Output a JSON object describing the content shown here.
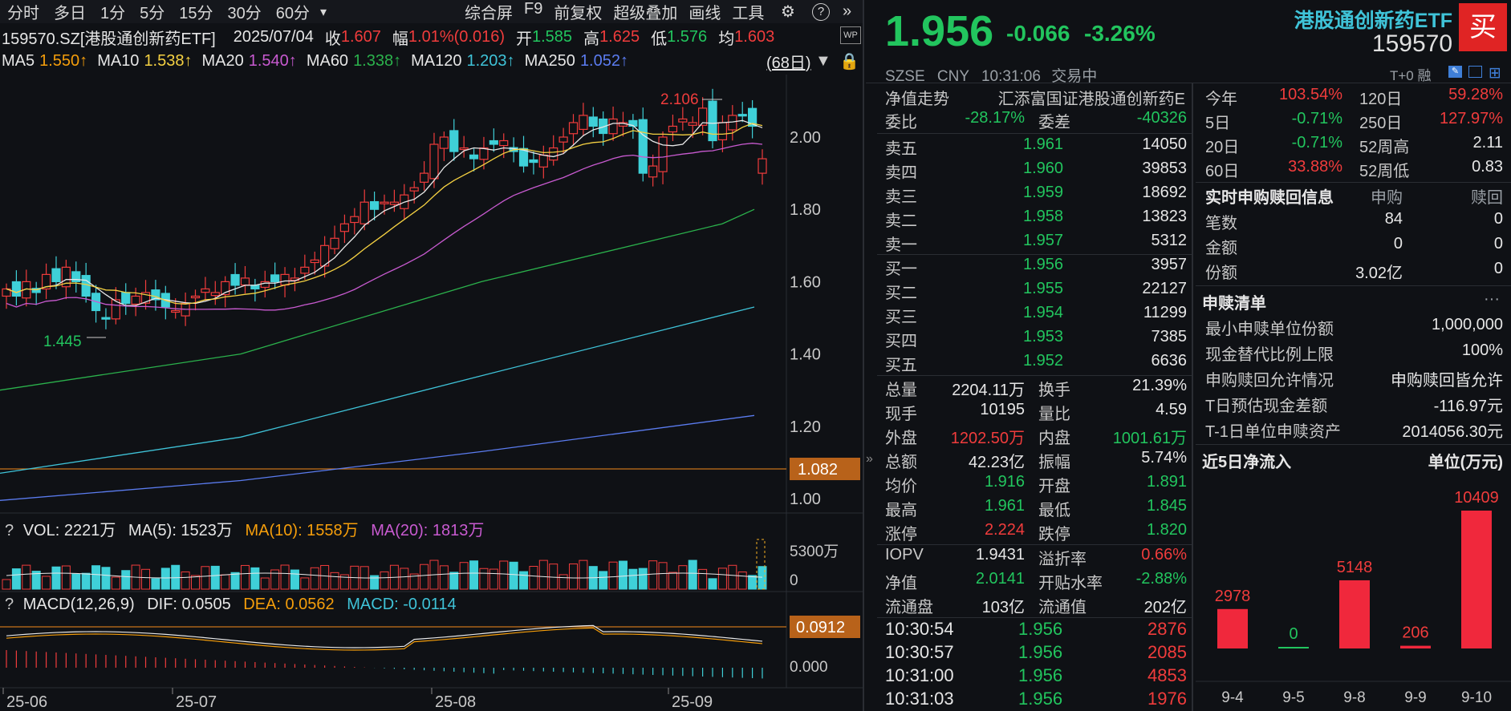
{
  "toolbar": {
    "periods": [
      "分时",
      "多日",
      "1分",
      "5分",
      "15分",
      "30分",
      "60分"
    ],
    "more": "▾",
    "tools": [
      "综合屏",
      "F9",
      "前复权",
      "超级叠加",
      "画线",
      "工具"
    ]
  },
  "info": {
    "code": "159570.SZ[港股通创新药ETF]",
    "date": "2025/07/04",
    "close_l": "收",
    "close": "1.607",
    "amp_l": "幅",
    "amp": "1.01%(0.016)",
    "open_l": "开",
    "open": "1.585",
    "high_l": "高",
    "high": "1.625",
    "low_l": "低",
    "low": "1.576",
    "avg_l": "均",
    "avg": "1.603"
  },
  "ma": {
    "ma5": "MA5",
    "ma5v": "1.550↑",
    "ma10": "MA10",
    "ma10v": "1.538↑",
    "ma20": "MA20",
    "ma20v": "1.540↑",
    "ma60": "MA60",
    "ma60v": "1.338↑",
    "ma120": "MA120",
    "ma120v": "1.203↑",
    "ma250": "MA250",
    "ma250v": "1.052↑",
    "days": "(68日)"
  },
  "price_axis": [
    "2.00",
    "1.80",
    "1.60",
    "1.40",
    "1.20",
    "1.00"
  ],
  "price_annot": {
    "high": "2.106",
    "low": "1.445",
    "marker": "1.082",
    "macd_marker": "0.0912"
  },
  "vol": {
    "q": "?",
    "vol": "VOL: 2221万",
    "ma5": "MA(5): 1523万",
    "ma10": "MA(10): 1558万",
    "ma20": "MA(20): 1813万",
    "axis_top": "5300万",
    "axis_zero": "0"
  },
  "macd": {
    "q": "?",
    "name": "MACD(12,26,9)",
    "dif": "DIF: 0.0505",
    "dea": "DEA: 0.0562",
    "macd": "MACD: -0.0114",
    "axis_zero": "0.000"
  },
  "dates": [
    "25-06",
    "25-07",
    "25-08",
    "25-09"
  ],
  "quote": {
    "price": "1.956",
    "chg": "-0.066",
    "pct": "-3.26%",
    "name": "港股通创新药ETF",
    "code": "159570",
    "buy_label": "买",
    "exch": "SZSE",
    "cur": "CNY",
    "time": "10:31:06",
    "status": "交易中",
    "t0": "T+0 融"
  },
  "nav_row": {
    "label": "净值走势",
    "fund": "汇添富国证港股通创新药E"
  },
  "weibi": {
    "l1": "委比",
    "v1": "-28.17%",
    "l2": "委差",
    "v2": "-40326"
  },
  "asks": [
    {
      "l": "卖五",
      "p": "1.961",
      "v": "14050"
    },
    {
      "l": "卖四",
      "p": "1.960",
      "v": "39853"
    },
    {
      "l": "卖三",
      "p": "1.959",
      "v": "18692"
    },
    {
      "l": "卖二",
      "p": "1.958",
      "v": "13823"
    },
    {
      "l": "卖一",
      "p": "1.957",
      "v": "5312"
    }
  ],
  "bids": [
    {
      "l": "买一",
      "p": "1.956",
      "v": "3957"
    },
    {
      "l": "买二",
      "p": "1.955",
      "v": "22127"
    },
    {
      "l": "买三",
      "p": "1.954",
      "v": "11299"
    },
    {
      "l": "买四",
      "p": "1.953",
      "v": "7385"
    },
    {
      "l": "买五",
      "p": "1.952",
      "v": "6636"
    }
  ],
  "stats": [
    {
      "l1": "总量",
      "v1": "2204.11万",
      "c1": "w",
      "l2": "换手",
      "v2": "21.39%",
      "c2": "w"
    },
    {
      "l1": "现手",
      "v1": "10195",
      "c1": "w",
      "l2": "量比",
      "v2": "4.59",
      "c2": "w"
    },
    {
      "l1": "外盘",
      "v1": "1202.50万",
      "c1": "r",
      "l2": "内盘",
      "v2": "1001.61万",
      "c2": "g"
    },
    {
      "l1": "总额",
      "v1": "42.23亿",
      "c1": "w",
      "l2": "振幅",
      "v2": "5.74%",
      "c2": "w"
    },
    {
      "l1": "均价",
      "v1": "1.916",
      "c1": "g",
      "l2": "开盘",
      "v2": "1.891",
      "c2": "g"
    },
    {
      "l1": "最高",
      "v1": "1.961",
      "c1": "g",
      "l2": "最低",
      "v2": "1.845",
      "c2": "g"
    },
    {
      "l1": "涨停",
      "v1": "2.224",
      "c1": "r",
      "l2": "跌停",
      "v2": "1.820",
      "c2": "g"
    }
  ],
  "iopv": [
    {
      "l1": "IOPV",
      "v1": "1.9431",
      "c1": "w",
      "l2": "溢折率",
      "v2": "0.66%",
      "c2": "r"
    },
    {
      "l1": "净值",
      "v1": "2.0141",
      "c1": "g",
      "l2": "开贴水率",
      "v2": "-2.88%",
      "c2": "g"
    },
    {
      "l1": "流通盘",
      "v1": "103亿",
      "c1": "w",
      "l2": "流通值",
      "v2": "202亿",
      "c2": "w"
    }
  ],
  "ticks": [
    {
      "t": "10:30:54",
      "p": "1.956",
      "v": "2876"
    },
    {
      "t": "10:30:57",
      "p": "1.956",
      "v": "2085"
    },
    {
      "t": "10:31:00",
      "p": "1.956",
      "v": "4853"
    },
    {
      "t": "10:31:03",
      "p": "1.956",
      "v": "1976"
    }
  ],
  "perf": [
    {
      "l1": "今年",
      "v1": "103.54%",
      "c1": "r",
      "l2": "120日",
      "v2": "59.28%",
      "c2": "r"
    },
    {
      "l1": "5日",
      "v1": "-0.71%",
      "c1": "g",
      "l2": "250日",
      "v2": "127.97%",
      "c2": "r"
    },
    {
      "l1": "20日",
      "v1": "-0.71%",
      "c1": "g",
      "l2": "52周高",
      "v2": "2.11",
      "c2": "w"
    },
    {
      "l1": "60日",
      "v1": "33.88%",
      "c1": "r",
      "l2": "52周低",
      "v2": "0.83",
      "c2": "w"
    }
  ],
  "subred": {
    "title": "实时申购赎回信息",
    "h1": "申购",
    "h2": "赎回",
    "rows": [
      {
        "l": "笔数",
        "a": "84",
        "b": "0"
      },
      {
        "l": "金额",
        "a": "0",
        "b": "0"
      },
      {
        "l": "份额",
        "a": "3.02亿",
        "b": "0"
      }
    ]
  },
  "list": {
    "title": "申赎清单",
    "rows": [
      {
        "l": "最小申赎单位份额",
        "v": "1,000,000"
      },
      {
        "l": "现金替代比例上限",
        "v": "100%"
      },
      {
        "l": "申购赎回允许情况",
        "v": "申购赎回皆允许"
      },
      {
        "l": "T日预估现金差额",
        "v": "-116.97元"
      },
      {
        "l": "T-1日单位申赎资产",
        "v": "2014056.30元"
      }
    ]
  },
  "flow": {
    "title": "近5日净流入",
    "unit": "单位(万元)"
  },
  "chart_data": {
    "type": "bar",
    "categories": [
      "9-4",
      "9-5",
      "9-8",
      "9-9",
      "9-10"
    ],
    "values": [
      2978,
      0,
      5148,
      206,
      10409
    ],
    "title": "近5日净流入",
    "ylabel": "单位(万元)"
  }
}
